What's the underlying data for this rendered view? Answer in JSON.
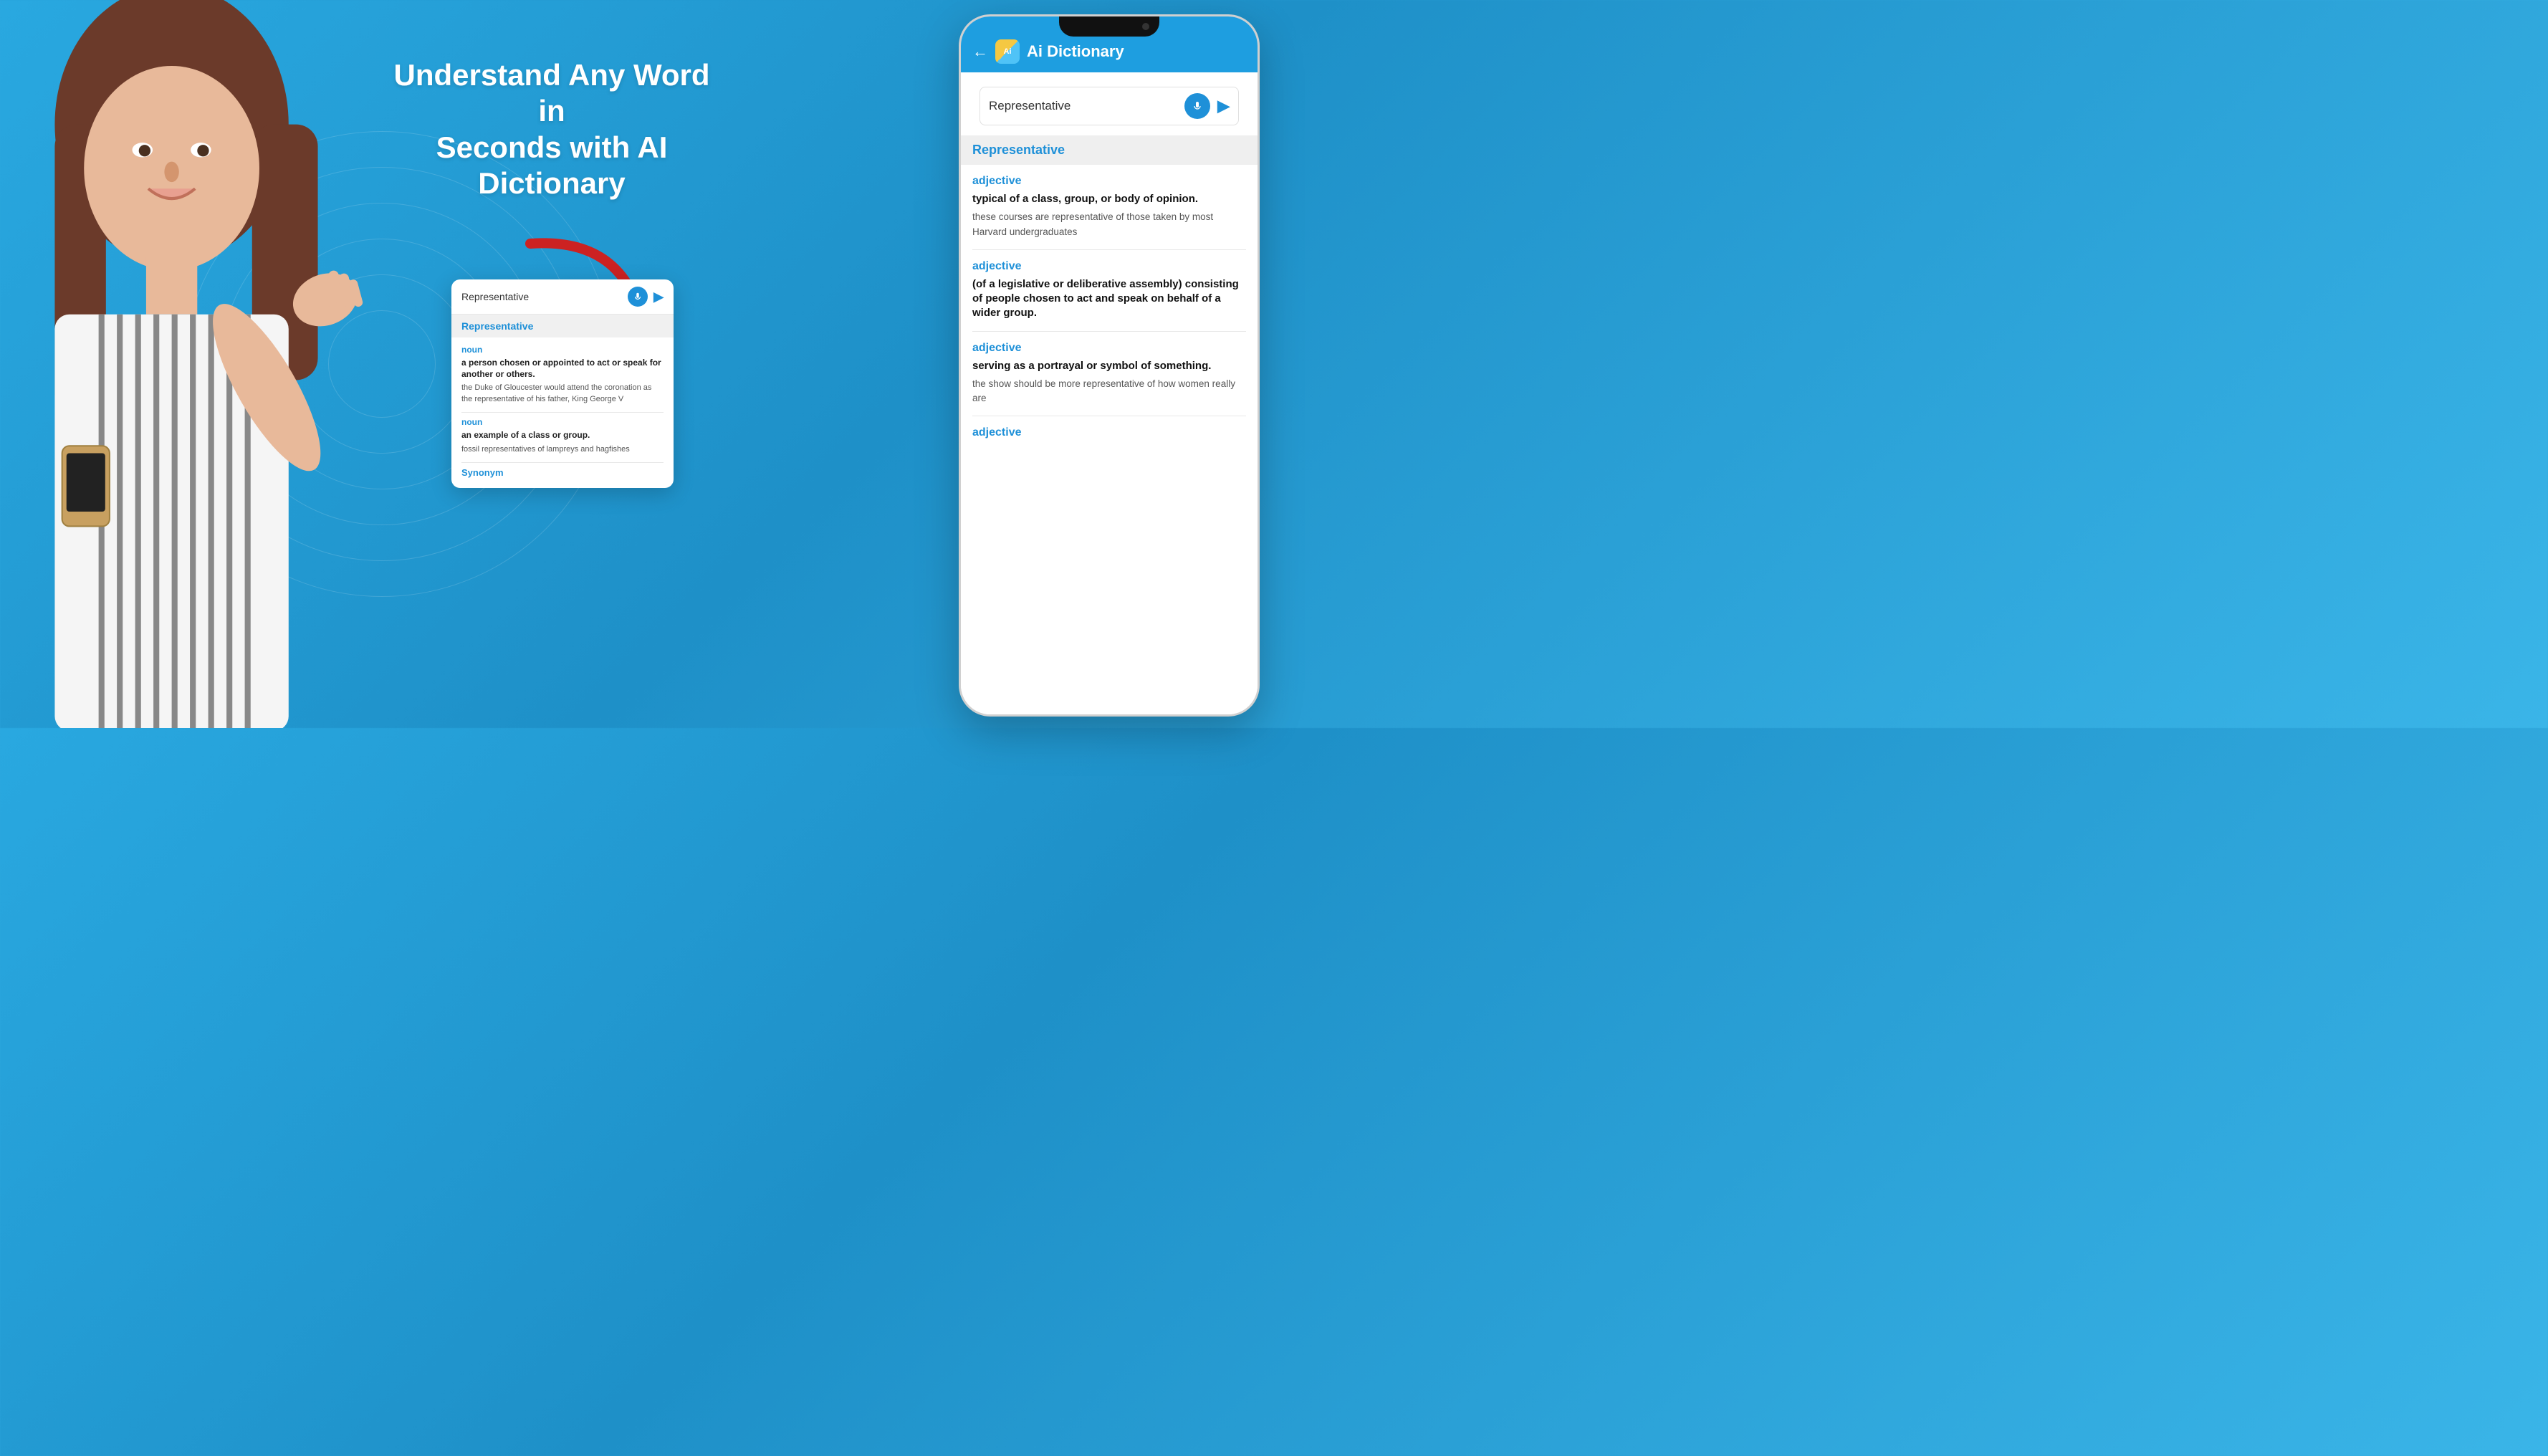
{
  "background": {
    "color": "#29a8e0"
  },
  "headline": {
    "line1": "Understand Any Word in",
    "line2": "Seconds with AI Dictionary",
    "full": "Understand Any Word in Seconds with AI Dictionary"
  },
  "app": {
    "title": "Ai Dictionary",
    "back_icon": "←",
    "icon_letter": "Ai"
  },
  "search": {
    "query": "Representative",
    "placeholder": "Representative",
    "mic_icon": "🎤",
    "send_icon": "▶"
  },
  "result_word": "Representative",
  "definitions": [
    {
      "pos": "adjective",
      "definition": "typical of a class, group, or body of opinion.",
      "example": "these courses are representative of those taken by most Harvard undergraduates"
    },
    {
      "pos": "adjective",
      "definition": "(of a legislative or deliberative assembly) consisting of people chosen to act and speak on behalf of a wider group.",
      "example": ""
    },
    {
      "pos": "adjective",
      "definition": "serving as a portrayal or symbol of something.",
      "example": "the show should be more representative of how women really are"
    }
  ],
  "small_card": {
    "search_text": "Representative",
    "result_word": "Representative",
    "definitions": [
      {
        "pos": "noun",
        "definition": "a person chosen or appointed to act or speak for another or others.",
        "example": "the Duke of Gloucester would attend the coronation as the representative of his father, King George V"
      },
      {
        "pos": "noun",
        "definition": "an example of a class or group.",
        "example": "fossil representatives of lampreys and hagfishes"
      }
    ],
    "synonym_label": "Synonym"
  }
}
